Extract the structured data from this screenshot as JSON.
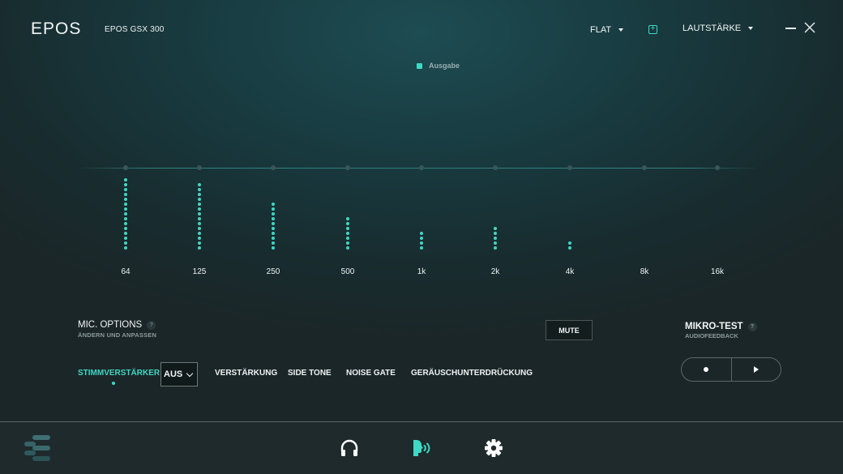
{
  "header": {
    "logo": "EPOS",
    "device_name": "EPOS GSX 300",
    "preset": "FLAT",
    "add_preset_icon": "plus-square-icon",
    "mode": "LAUTSTÄRKE",
    "minimize_icon": "minimize-icon",
    "close_icon": "close-icon"
  },
  "equalizer": {
    "legend": "Ausgabe",
    "accent_color": "#3fd8c4",
    "max_level_dots": 15,
    "bands": [
      {
        "label": "64",
        "level": 15
      },
      {
        "label": "125",
        "level": 14
      },
      {
        "label": "250",
        "level": 10
      },
      {
        "label": "500",
        "level": 7
      },
      {
        "label": "1k",
        "level": 4
      },
      {
        "label": "2k",
        "level": 5
      },
      {
        "label": "4k",
        "level": 2
      },
      {
        "label": "8k",
        "level": 0
      },
      {
        "label": "16k",
        "level": 0
      }
    ]
  },
  "mic_options": {
    "title": "MIC. OPTIONS",
    "subtitle": "ÄNDERN UND ANPASSEN",
    "help": "?",
    "mute_label": "MUTE",
    "tabs": [
      {
        "label": "STIMMVERSTÄRKER",
        "active": true
      },
      {
        "label": "VERSTÄRKUNG",
        "active": false
      },
      {
        "label": "SIDE TONE",
        "active": false
      },
      {
        "label": "NOISE GATE",
        "active": false
      },
      {
        "label": "GERÄUSCHUNTERDRÜCKUNG",
        "active": false
      }
    ],
    "select_value": "AUS"
  },
  "mic_test": {
    "title": "MIKRO-TEST",
    "subtitle": "AUDIOFEEDBACK",
    "help": "?",
    "record_icon": "record-icon",
    "play_icon": "play-icon"
  },
  "bottom_nav": {
    "menu_icon": "menu-icon",
    "items": [
      {
        "icon": "headphones-icon",
        "active": false
      },
      {
        "icon": "microphone-voice-icon",
        "active": true
      },
      {
        "icon": "gear-icon",
        "active": false
      }
    ]
  }
}
